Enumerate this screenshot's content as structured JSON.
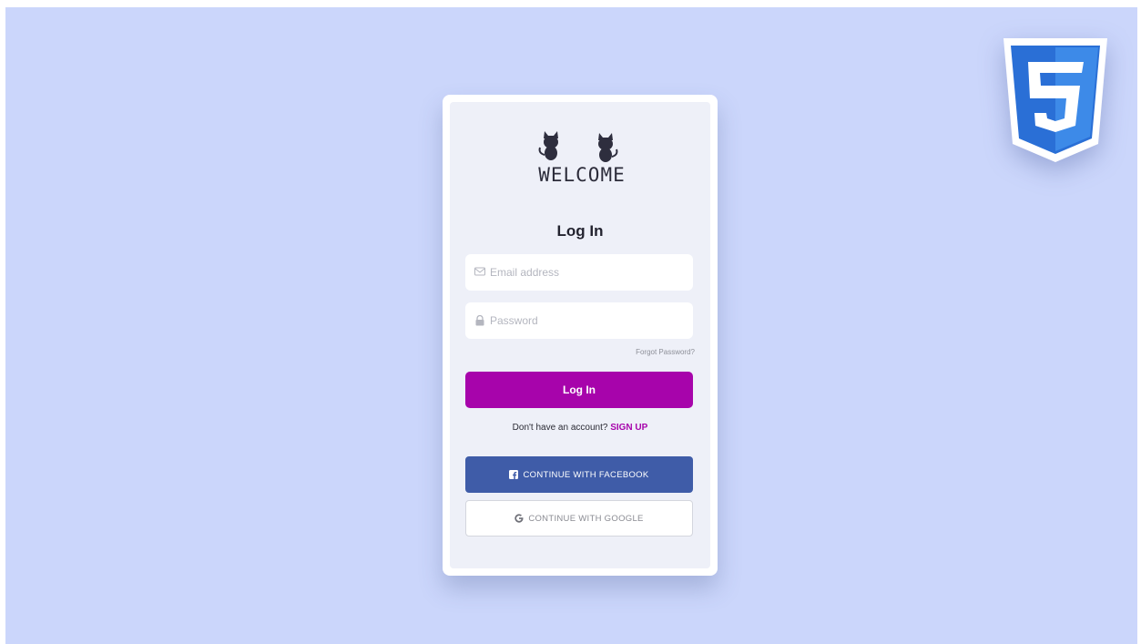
{
  "logo": {
    "text": "WELCOME"
  },
  "login": {
    "title": "Log In",
    "email": {
      "placeholder": "Email address",
      "value": "",
      "icon": "envelope-icon"
    },
    "password": {
      "placeholder": "Password",
      "value": "",
      "icon": "lock-icon"
    },
    "forgot_label": "Forgot Password?",
    "submit_label": "Log In",
    "signup_prompt": "Don't have an account?",
    "signup_link": "SIGN UP"
  },
  "social": {
    "facebook_label": "CONTINUE WITH FACEBOOK",
    "facebook_icon": "facebook-icon",
    "google_label": "CONTINUE WITH GOOGLE",
    "google_icon": "google-icon"
  },
  "colors": {
    "background": "#cbd6fb",
    "accent": "#a704ab",
    "facebook": "#3f5ca8",
    "css3_badge": "#2a6fd6"
  },
  "badge": {
    "icon": "css3-logo-icon"
  }
}
